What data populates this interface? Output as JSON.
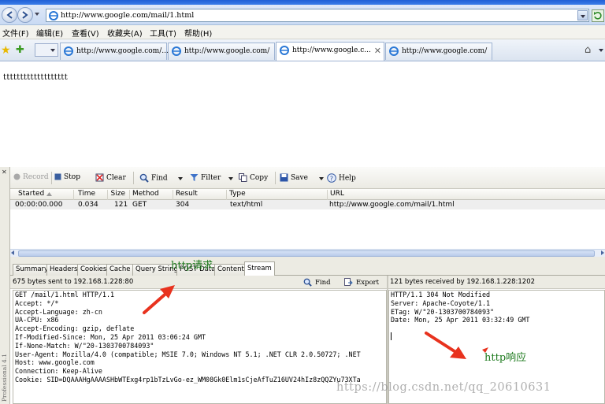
{
  "browser": {
    "url": "http://www.google.com/mail/1.html",
    "menu": [
      "文件(F)",
      "编辑(E)",
      "查看(V)",
      "收藏夹(A)",
      "工具(T)",
      "帮助(H)"
    ],
    "tabs": [
      {
        "title": "http://www.google.com/...",
        "active": false
      },
      {
        "title": "http://www.google.com/",
        "active": false
      },
      {
        "title": "http://www.google.c...",
        "active": true
      },
      {
        "title": "http://www.google.com/",
        "active": false
      }
    ]
  },
  "page": {
    "content": "ttttttttttttttttttt"
  },
  "fiddler": {
    "toolbar": {
      "record": "Record",
      "stop": "Stop",
      "clear": "Clear",
      "find": "Find",
      "filter": "Filter",
      "copy": "Copy",
      "save": "Save",
      "help": "Help"
    },
    "columns": [
      "Started",
      "Time",
      "Size",
      "Method",
      "Result",
      "Type",
      "URL"
    ],
    "session": {
      "started": "00:00:00.000",
      "time": "0.034",
      "size": "121",
      "method": "GET",
      "result": "304",
      "type": "text/html",
      "url": "http://www.google.com/mail/1.html"
    },
    "inspector_tabs": [
      "Summary",
      "Headers",
      "Cookies",
      "Cache",
      "Query String",
      "POST Data",
      "Content",
      "Stream"
    ],
    "active_tab": "Stream",
    "request": {
      "info": "675 bytes sent to 192.168.1.228:80",
      "find": "Find",
      "export": "Export",
      "lines": [
        "GET /mail/1.html HTTP/1.1",
        "Accept: */*",
        "Accept-Language: zh-cn",
        "UA-CPU: x86",
        "Accept-Encoding: gzip, deflate",
        "If-Modified-Since: Mon, 25 Apr 2011 03:06:24 GMT",
        "If-None-Match: W/\"20-1303700784093\"",
        "User-Agent: Mozilla/4.0 (compatible; MSIE 7.0; Windows NT 5.1; .NET CLR 2.0.50727; .NET",
        "Host: www.google.com",
        "Connection: Keep-Alive",
        "Cookie: SID=DQAAAHgAAAASHbWTExg4rp1bTzLvGo-ez_WM08Gk0Elm1sCjeAfTuZ16UV24hIz8zQQZYu73XTa"
      ]
    },
    "response": {
      "info": "121 bytes received by 192.168.1.228:1202",
      "lines": [
        "HTTP/1.1 304 Not Modified",
        "Server: Apache-Coyote/1.1",
        "ETag: W/\"20-1303700784093\"",
        "Date: Mon, 25 Apr 2011 03:32:49 GMT"
      ]
    },
    "side_label": "Professional 4.1"
  },
  "annotations": {
    "request_label": "http请求",
    "response_label": "http响应",
    "arrow_color": "#e8321e"
  },
  "watermark": "https://blog.csdn.net/qq_20610631"
}
